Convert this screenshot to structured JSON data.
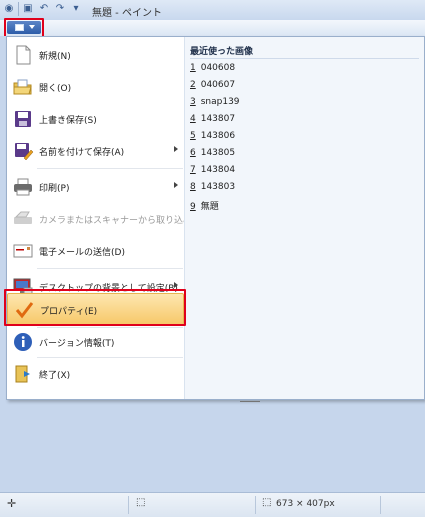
{
  "window": {
    "title": "無題 - ペイント"
  },
  "qat": {
    "icons": [
      "paint-app-icon",
      "save-icon",
      "undo-icon",
      "redo-icon",
      "customize-icon"
    ]
  },
  "menu": {
    "items": [
      {
        "label": "新規(N)",
        "icon": "new-file-icon",
        "submenu": false,
        "disabled": false
      },
      {
        "label": "開く(O)",
        "icon": "open-folder-icon",
        "submenu": false,
        "disabled": false
      },
      {
        "label": "上書き保存(S)",
        "icon": "save-icon",
        "submenu": false,
        "disabled": false
      },
      {
        "label": "名前を付けて保存(A)",
        "icon": "save-as-icon",
        "submenu": true,
        "disabled": false
      },
      {
        "label": "印刷(P)",
        "icon": "printer-icon",
        "submenu": true,
        "disabled": false
      },
      {
        "label": "カメラまたはスキャナーから取り込み(M)",
        "icon": "scanner-icon",
        "submenu": false,
        "disabled": true
      },
      {
        "label": "電子メールの送信(D)",
        "icon": "email-icon",
        "submenu": false,
        "disabled": false
      },
      {
        "label": "デスクトップの背景として設定(B)",
        "icon": "desktop-background-icon",
        "submenu": true,
        "disabled": false
      },
      {
        "label": "プロパティ(E)",
        "icon": "properties-check-icon",
        "submenu": false,
        "disabled": false,
        "highlighted": true
      },
      {
        "label": "バージョン情報(T)",
        "icon": "info-icon",
        "submenu": false,
        "disabled": false
      },
      {
        "label": "終了(X)",
        "icon": "exit-icon",
        "submenu": false,
        "disabled": false
      }
    ]
  },
  "recent": {
    "title": "最近使った画像",
    "items": [
      {
        "num": "1",
        "name": "040608"
      },
      {
        "num": "2",
        "name": "040607"
      },
      {
        "num": "3",
        "name": "snap139"
      },
      {
        "num": "4",
        "name": "143807"
      },
      {
        "num": "5",
        "name": "143806"
      },
      {
        "num": "6",
        "name": "143805"
      },
      {
        "num": "7",
        "name": "143804"
      },
      {
        "num": "8",
        "name": "143803"
      },
      {
        "num": "9",
        "name": "無題"
      }
    ]
  },
  "status": {
    "size_text": "673 × 407px"
  },
  "colors": {
    "highlight": "#f7c96a",
    "annotation": "#e0001b"
  }
}
